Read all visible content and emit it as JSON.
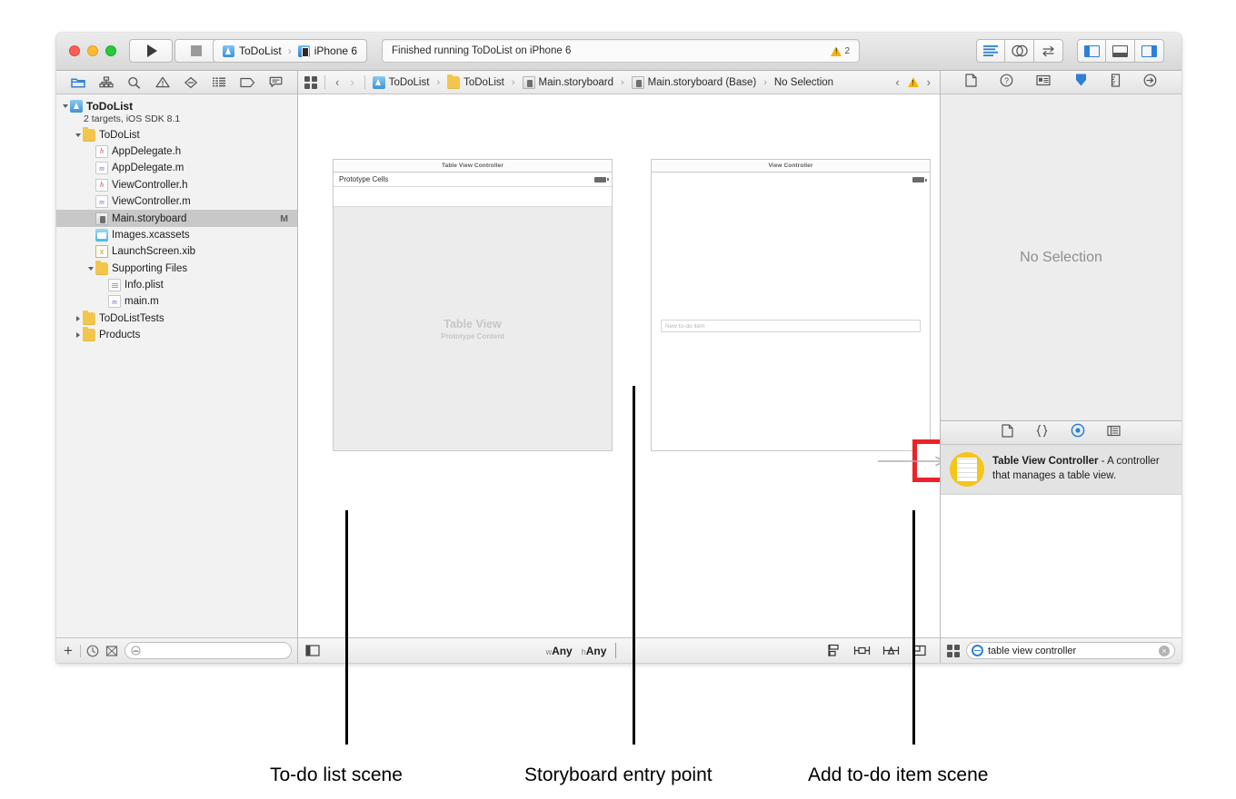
{
  "window": {
    "traffic_lights": [
      "close",
      "minimize",
      "zoom"
    ]
  },
  "toolbar": {
    "run_button": "run-icon",
    "stop_button": "stop-icon",
    "scheme_name": "ToDoList",
    "scheme_separator": "›",
    "destination_name": "iPhone 6",
    "activity_status": "Finished running ToDoList on iPhone 6",
    "warning_count": "2",
    "editor_modes": [
      "standard-editor",
      "assistant-editor",
      "version-editor"
    ],
    "view_toggles": [
      "navigator-toggle",
      "debug-toggle",
      "utilities-toggle"
    ]
  },
  "navigator": {
    "tabs": [
      "project-navigator-icon",
      "symbol-navigator-icon",
      "search-navigator-icon",
      "issue-navigator-icon",
      "test-navigator-icon",
      "debug-navigator-icon",
      "breakpoint-navigator-icon",
      "report-navigator-icon"
    ],
    "tree": [
      {
        "label": "ToDoList",
        "sub": "2 targets, iOS SDK 8.1",
        "icon": "project-icon",
        "indent": 0,
        "twisty": "open",
        "bold": true
      },
      {
        "label": "ToDoList",
        "icon": "folder-icon",
        "indent": 1,
        "twisty": "open"
      },
      {
        "label": "AppDelegate.h",
        "icon": "header-file-icon",
        "indent": 2,
        "twisty": "none"
      },
      {
        "label": "AppDelegate.m",
        "icon": "source-file-icon",
        "indent": 2,
        "twisty": "none"
      },
      {
        "label": "ViewController.h",
        "icon": "header-file-icon",
        "indent": 2,
        "twisty": "none"
      },
      {
        "label": "ViewController.m",
        "icon": "source-file-icon",
        "indent": 2,
        "twisty": "none"
      },
      {
        "label": "Main.storyboard",
        "icon": "storyboard-icon",
        "indent": 2,
        "twisty": "none",
        "status": "M",
        "selected": true
      },
      {
        "label": "Images.xcassets",
        "icon": "assets-icon",
        "indent": 2,
        "twisty": "none"
      },
      {
        "label": "LaunchScreen.xib",
        "icon": "xib-icon",
        "indent": 2,
        "twisty": "none"
      },
      {
        "label": "Supporting Files",
        "icon": "folder-icon",
        "indent": 2,
        "twisty": "open"
      },
      {
        "label": "Info.plist",
        "icon": "plist-icon",
        "indent": 3,
        "twisty": "none"
      },
      {
        "label": "main.m",
        "icon": "source-file-icon",
        "indent": 3,
        "twisty": "none"
      },
      {
        "label": "ToDoListTests",
        "icon": "folder-icon",
        "indent": 1,
        "twisty": "closed"
      },
      {
        "label": "Products",
        "icon": "folder-icon",
        "indent": 1,
        "twisty": "closed"
      }
    ],
    "footer": {
      "add_label": "+",
      "icons": [
        "recent-files-icon",
        "source-control-icon"
      ],
      "filter_placeholder": ""
    }
  },
  "jumpbar": {
    "related_items_icon": "related-items-icon",
    "back_arrow": "‹",
    "forward_arrow": "›",
    "separator": "›",
    "crumbs": [
      {
        "label": "ToDoList",
        "icon": "project-icon"
      },
      {
        "label": "ToDoList",
        "icon": "folder-icon"
      },
      {
        "label": "Main.storyboard",
        "icon": "storyboard-icon"
      },
      {
        "label": "Main.storyboard (Base)",
        "icon": "storyboard-icon"
      },
      {
        "label": "No Selection",
        "icon": "none"
      }
    ],
    "issue_prev": "‹",
    "issue_icon": "warning-icon",
    "issue_next": "›"
  },
  "canvas": {
    "scene_a": {
      "title": "Table View Controller",
      "prototype_header": "Prototype Cells",
      "placeholder_title": "Table View",
      "placeholder_subtitle": "Prototype Content"
    },
    "scene_b": {
      "title": "View Controller",
      "textfield_placeholder": "New to-do item"
    },
    "entry_point": {
      "icon": "entry-point-arrow-icon",
      "highlight_color": "#ec2227"
    }
  },
  "editor_footer": {
    "document_outline_icon": "document-outline-icon",
    "size_class_w_prefix": "w",
    "size_class_w_value": "Any",
    "size_class_h_prefix": "h",
    "size_class_h_value": "Any",
    "icons": [
      "align-icon",
      "pin-icon",
      "resolve-issues-icon",
      "resizing-icon"
    ]
  },
  "utilities": {
    "inspector_tabs": [
      "file-inspector-icon",
      "quick-help-icon",
      "identity-inspector-icon",
      "attributes-inspector-icon",
      "size-inspector-icon",
      "connections-inspector-icon"
    ],
    "active_inspector": "attributes-inspector-icon",
    "inspector_empty_text": "No Selection",
    "library_tabs": [
      "file-template-library-icon",
      "code-snippet-library-icon",
      "object-library-icon",
      "media-library-icon"
    ],
    "active_library": "object-library-icon",
    "library_items": [
      {
        "title": "Table View Controller",
        "description": " - A controller that manages a table view.",
        "icon": "table-view-controller-icon",
        "icon_color": "#f5c518"
      }
    ],
    "library_footer": {
      "layout_toggle_icon": "grid-view-icon",
      "filter_icon": "object-filter-icon",
      "filter_value": "table view controller",
      "clear_icon": "clear-icon"
    }
  },
  "callouts": [
    {
      "label": "To-do list scene"
    },
    {
      "label": "Storyboard entry point"
    },
    {
      "label": "Add to-do item scene"
    }
  ]
}
